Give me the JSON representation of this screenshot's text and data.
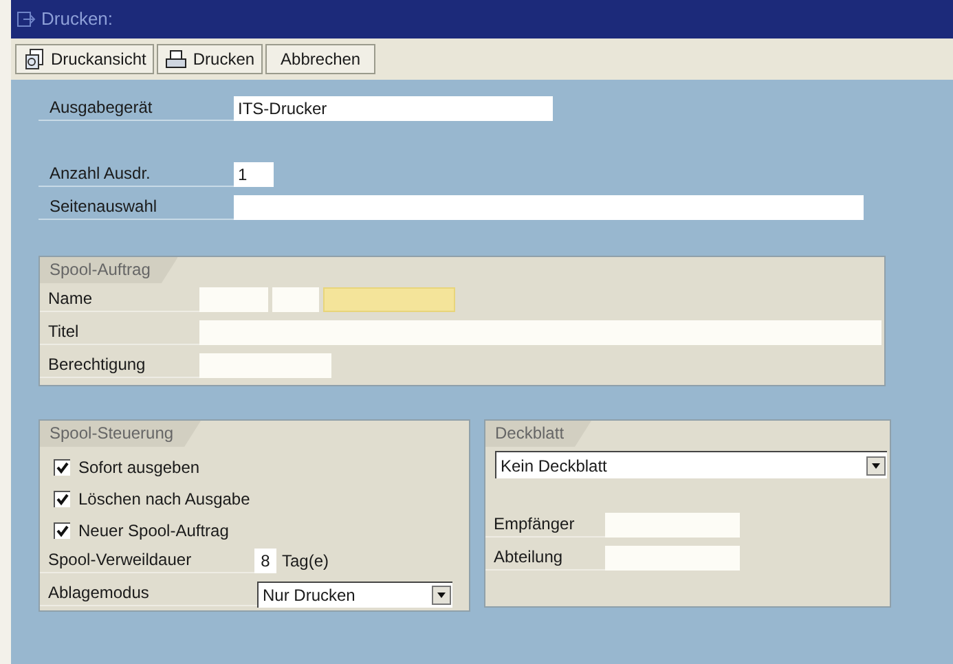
{
  "window": {
    "title": "Drucken:"
  },
  "toolbar": [
    {
      "label": "Druckansicht",
      "kind": "preview"
    },
    {
      "label": "Drucken",
      "kind": "print"
    },
    {
      "label": "Abbrechen",
      "kind": "plain"
    }
  ],
  "fields": [
    {
      "label": "Ausgabegerät",
      "value": "ITS-Drucker"
    },
    {
      "label": "Anzahl Ausdr.",
      "value": "1"
    },
    {
      "label": "Seitenauswahl"
    }
  ],
  "spool_auftrag": {
    "title": "Spool-Auftrag",
    "name": {
      "label": "Name",
      "parts": [
        {
          "highlighted": false
        },
        {
          "highlighted": false
        },
        {
          "highlighted": true
        }
      ]
    },
    "titel": {
      "label": "Titel"
    },
    "berechtigung": {
      "label": "Berechtigung"
    }
  },
  "spool_steuerung": {
    "title": "Spool-Steuerung",
    "options": [
      {
        "label": "Sofort ausgeben",
        "checked": true
      },
      {
        "label": "Löschen nach Ausgabe",
        "checked": true
      },
      {
        "label": "Neuer Spool-Auftrag",
        "checked": true
      }
    ],
    "verweildauer": {
      "label": "Spool-Verweildauer",
      "value": "8",
      "unit": "Tag(e)"
    },
    "ablagemodus": {
      "label": "Ablagemodus",
      "value": "Nur Drucken"
    }
  },
  "deckblatt": {
    "title": "Deckblatt",
    "select": {
      "value": "Kein Deckblatt"
    },
    "fields": [
      {
        "label": "Empfänger"
      },
      {
        "label": "Abteilung"
      }
    ]
  }
}
